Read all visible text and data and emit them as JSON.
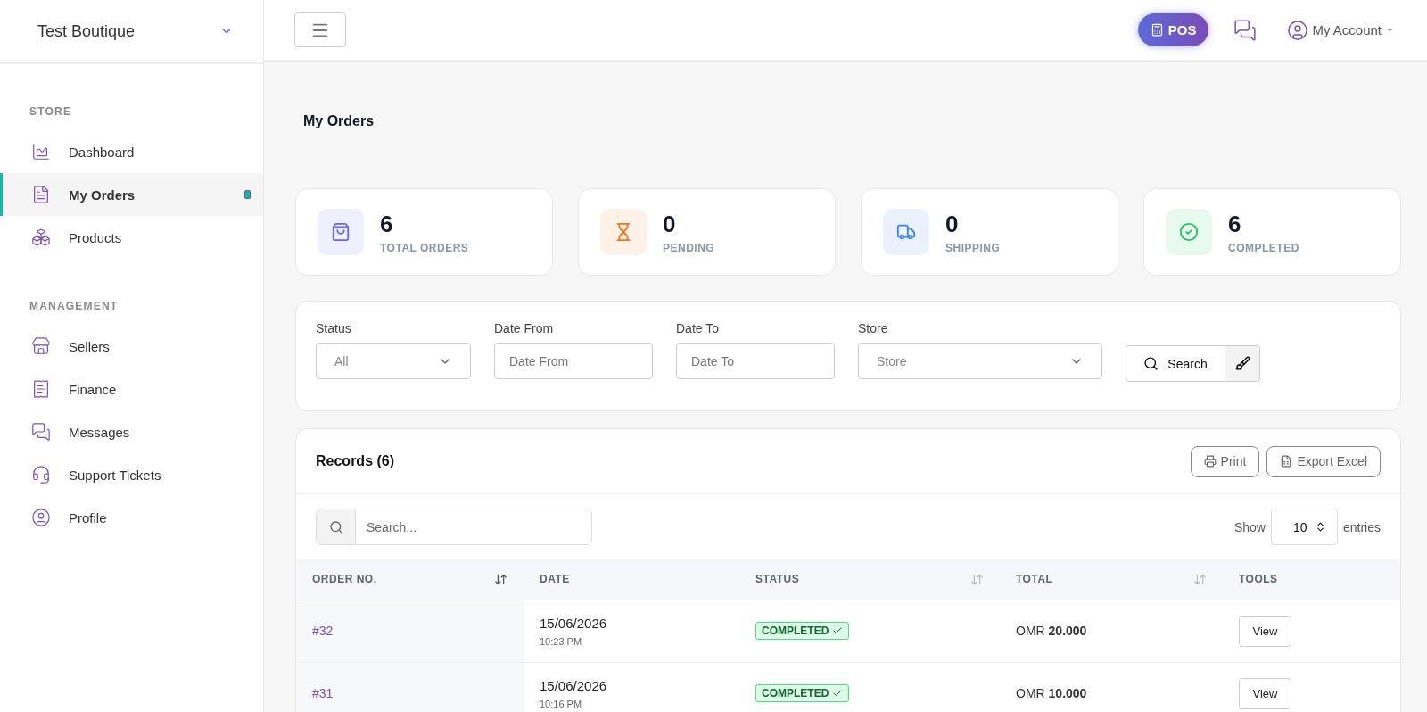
{
  "store_selector": {
    "name": "Test Boutique"
  },
  "sidebar": {
    "sections": [
      {
        "title": "STORE",
        "items": [
          {
            "label": "Dashboard",
            "selected": false
          },
          {
            "label": "My Orders",
            "selected": true
          },
          {
            "label": "Products",
            "selected": false
          }
        ]
      },
      {
        "title": "MANAGEMENT",
        "items": [
          {
            "label": "Sellers",
            "selected": false
          },
          {
            "label": "Finance",
            "selected": false
          },
          {
            "label": "Messages",
            "selected": false
          },
          {
            "label": "Support Tickets",
            "selected": false
          },
          {
            "label": "Profile",
            "selected": false
          }
        ]
      }
    ]
  },
  "topbar": {
    "pos_button": "POS",
    "account": "My Account"
  },
  "page_title": "My Orders",
  "stats": [
    {
      "value": "6",
      "label": "TOTAL ORDERS",
      "color": "#6366f1"
    },
    {
      "value": "0",
      "label": "PENDING",
      "color": "#f97316"
    },
    {
      "value": "0",
      "label": "SHIPPING",
      "color": "#3b82f6"
    },
    {
      "value": "6",
      "label": "COMPLETED",
      "color": "#22c55e"
    }
  ],
  "filters": [
    {
      "label": "Status",
      "kind": "select",
      "placeholder": "All"
    },
    {
      "label": "Date From",
      "kind": "text",
      "placeholder": "Date From"
    },
    {
      "label": "Date To",
      "kind": "text",
      "placeholder": "Date To"
    },
    {
      "label": "Store",
      "kind": "select",
      "placeholder": "Store"
    }
  ],
  "search_button": "Search",
  "records": {
    "title": "Records (6)",
    "actions": [
      "Print",
      "Export Excel"
    ],
    "search_placeholder": "Search...",
    "show_label": "Show",
    "entries_value": "10",
    "entries_label": "entries",
    "columns": [
      {
        "label": "ORDER NO.",
        "sortable": true,
        "sorted": true
      },
      {
        "label": "DATE",
        "sortable": false
      },
      {
        "label": "STATUS",
        "sortable": true,
        "sorted": false
      },
      {
        "label": "TOTAL",
        "sortable": true,
        "sorted": false
      },
      {
        "label": "TOOLS",
        "sortable": false
      }
    ],
    "rows": [
      {
        "order": "#32",
        "date": "15/06/2026",
        "time": "10:23 PM",
        "status": "COMPLETED",
        "currency": "OMR",
        "total": "20.000",
        "action": "View"
      },
      {
        "order": "#31",
        "date": "15/06/2026",
        "time": "10:16 PM",
        "status": "COMPLETED",
        "currency": "OMR",
        "total": "10.000",
        "action": "View"
      }
    ]
  }
}
